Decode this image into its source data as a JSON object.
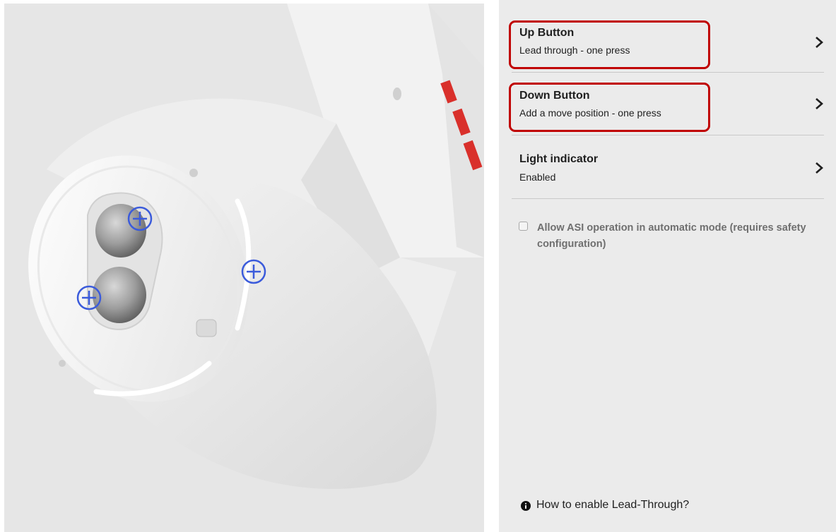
{
  "settings": {
    "items": [
      {
        "title": "Up Button",
        "subtitle": "Lead through - one press"
      },
      {
        "title": "Down Button",
        "subtitle": "Add a move position - one press"
      },
      {
        "title": "Light indicator",
        "subtitle": "Enabled"
      }
    ],
    "asi_option": {
      "label": "Allow ASI operation in automatic mode (requires safety configuration)",
      "checked": false
    },
    "help_link": "How to enable Lead-Through?"
  },
  "icons": {
    "row_chevron": "chevron-right-icon",
    "hotspot": "plus-circle-icon",
    "help": "info-circle-icon"
  },
  "colors": {
    "highlight": "#c00000",
    "hotspot": "#3b5bdb",
    "panel_bg": "#ebebeb",
    "image_bg": "#e6e6e6"
  }
}
